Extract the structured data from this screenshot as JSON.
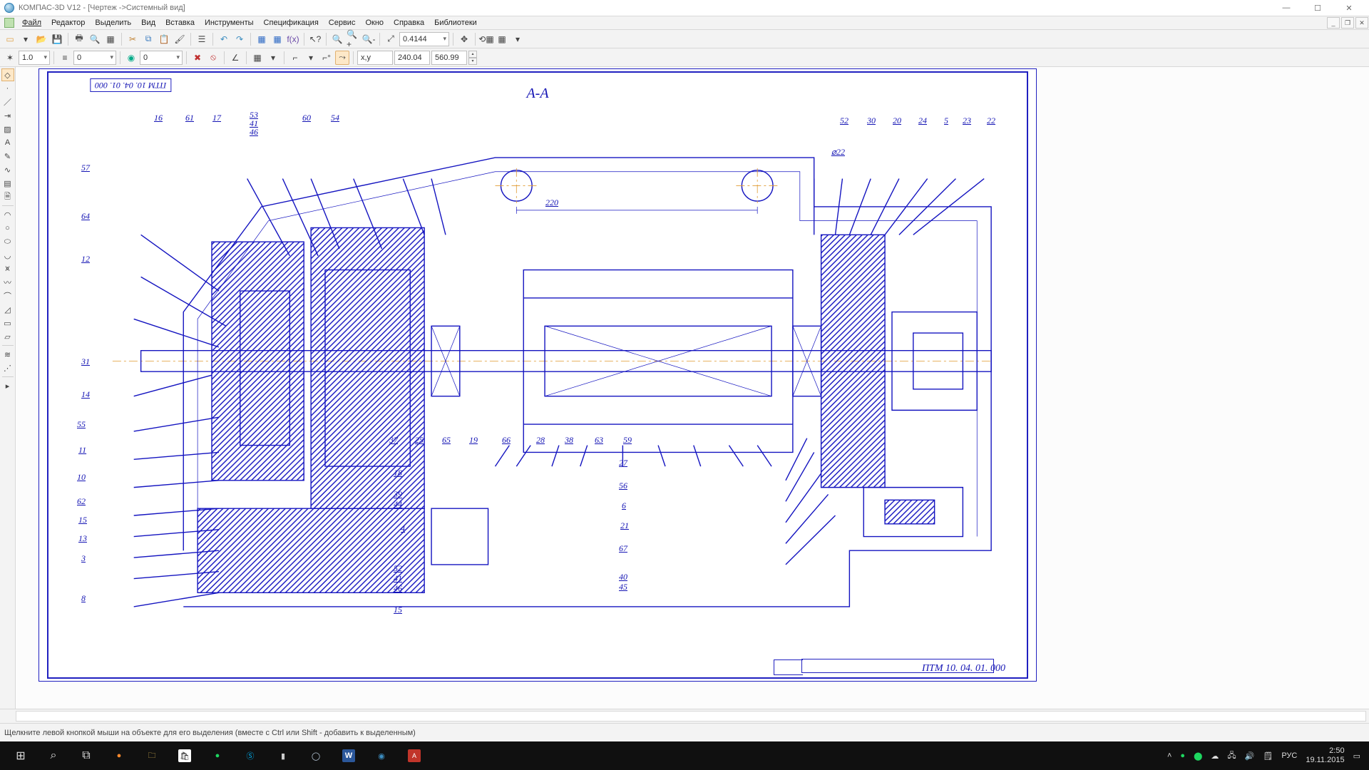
{
  "title": "КОМПАС-3D V12 - [Чертеж ->Системный вид]",
  "menu": [
    "Файл",
    "Редактор",
    "Выделить",
    "Вид",
    "Вставка",
    "Инструменты",
    "Спецификация",
    "Сервис",
    "Окно",
    "Справка",
    "Библиотеки"
  ],
  "toolbar1": {
    "zoom_value": "0.4144",
    "coord_x": "240.04",
    "coord_y": "560.99"
  },
  "toolbar2": {
    "line_weight": "1.0",
    "style_combo": "0",
    "layer_combo": "0"
  },
  "drawing": {
    "section": "А-А",
    "dim_220": "220",
    "drawing_id_top": "ПТМ 10. 04. 01. 000",
    "drawing_id_block": "ПТМ 10. 04. 01. 000",
    "angle_422": "⌀22",
    "callouts_top_left": [
      "16",
      "61",
      "17",
      "53",
      "41",
      "46",
      "60",
      "54"
    ],
    "callouts_top_right": [
      "52",
      "30",
      "20",
      "24",
      "5",
      "23",
      "22"
    ],
    "callouts_left": [
      "57",
      "64",
      "12",
      "31",
      "14",
      "55",
      "11",
      "10",
      "62",
      "15",
      "13",
      "3",
      "8"
    ],
    "callouts_bottom_mid": [
      "37",
      "25",
      "65",
      "19",
      "66",
      "28",
      "38",
      "63",
      "59"
    ],
    "callouts_right_col": [
      "27",
      "56",
      "6",
      "21",
      "67",
      "40",
      "45"
    ],
    "callouts_misc": [
      "18",
      "39",
      "44",
      "4",
      "52",
      "41",
      "46",
      "15"
    ]
  },
  "statusbar": "Щелкните левой кнопкой мыши на объекте для его выделения (вместе с Ctrl или Shift - добавить к выделенным)",
  "taskbar": {
    "lang": "РУС",
    "time": "2:50",
    "date": "19.11.2015"
  }
}
